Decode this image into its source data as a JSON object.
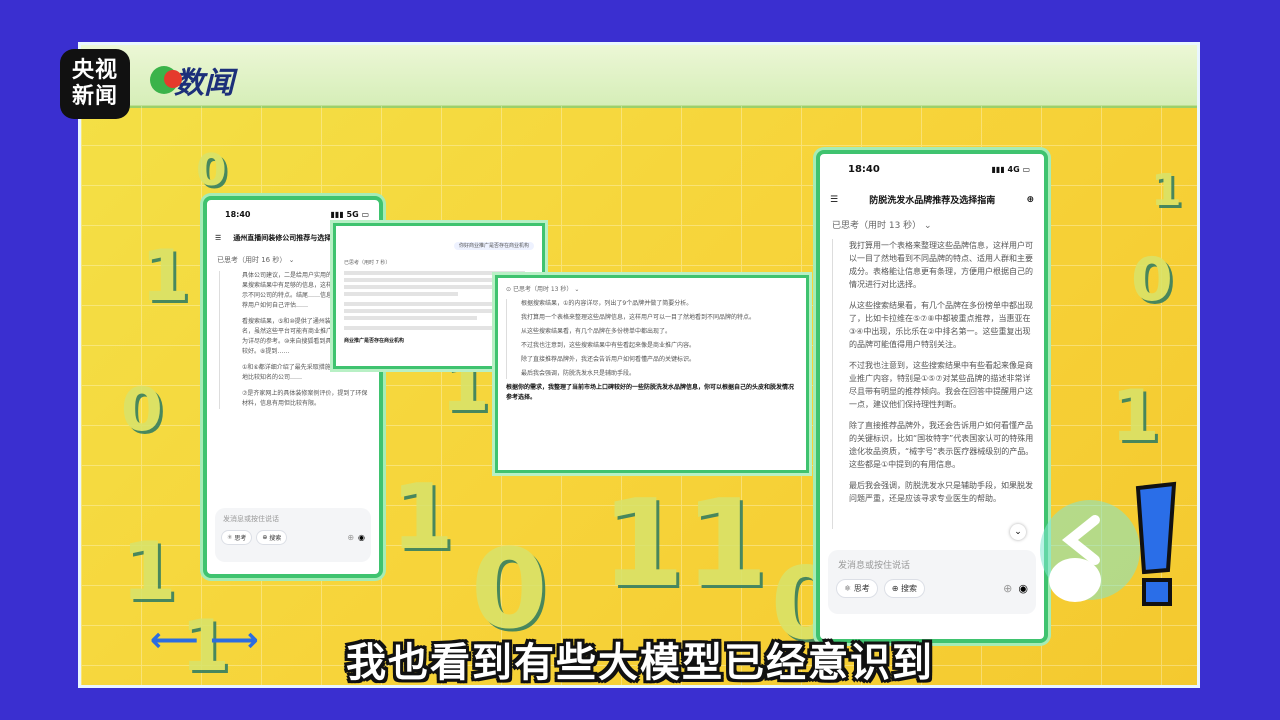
{
  "broadcaster": {
    "logo_line1": "央视",
    "logo_line2": "新闻",
    "brand_name": "数闻"
  },
  "subtitle": "我也看到有些大模型已经意识到",
  "phone_left": {
    "time": "18:40",
    "signal": "5G",
    "title": "通州直播间装修公司推荐与选择",
    "thinking": "已思考（用时 16 秒）",
    "paragraphs": [
      "具体公司建议，二是给用户实用的选择建议。如果搜索结果中有足够的信息，这样比较的方式展示不同公司的特点。结尾……信息，我会重点推荐用户如何自己评估……",
      "看搜索结果，⑤和⑩提供了通州装修公司综合排名，虽然这些平台可能有商业推广，但提供了较为详尽的参考。⑩来自搜狐看到具体信息，信誉较好。⑧提到……",
      "①和⑥都详细介绍了最先采取措施，这是通州本地比较知名的公司……",
      "⑦是齐家网上的具体装修案例评价，提到了环保材料，信息有用但比较有限。"
    ],
    "input_placeholder": "发消息或按住说话",
    "btn_think": "思考",
    "btn_search": "搜索"
  },
  "card_small": {
    "chip": "你好商业推广是否存在商业机构",
    "thinking": "已思考（用时 7 秒）",
    "footer": "商业推广是否存在商业机构"
  },
  "card_middle": {
    "thinking": "已思考（用时 13 秒）",
    "paragraphs": [
      "根据搜索结果，①的内容详尽，列出了9个品牌并做了简要分析。",
      "我打算用一个表格来整理这些品牌信息，这样用户可以一目了然地看到不同品牌的特点。",
      "从这些搜索结果看，有几个品牌在多份榜单中都出现了。",
      "不过我也注意到，这些搜索结果中有些看起来像是商业推广内容。",
      "除了直接推荐品牌外，我还会告诉用户如何看懂产品的关键标识。",
      "最后我会强调，防脱洗发水只是辅助手段。"
    ],
    "answer": "根据你的需求，我整理了当前市场上口碑较好的一些防脱洗发水品牌信息，你可以根据自己的头皮和脱发情况参考选择。"
  },
  "phone_right": {
    "time": "18:40",
    "signal": "4G",
    "title": "防脱洗发水品牌推荐及选择指南",
    "thinking": "已思考（用时 13 秒）",
    "paragraphs": [
      "我打算用一个表格来整理这些品牌信息，这样用户可以一目了然地看到不同品牌的特点、适用人群和主要成分。表格能让信息更有条理，方便用户根据自己的情况进行对比选择。",
      "从这些搜索结果看，有几个品牌在多份榜单中都出现了，比如卡拉维在⑤⑦⑧中都被重点推荐，当惠亚在③④中出现，乐比乐在②中排名第一。这些重复出现的品牌可能值得用户特别关注。",
      "不过我也注意到，这些搜索结果中有些看起来像是商业推广内容，特别是①⑤⑦对某些品牌的描述非常详尽且带有明显的推荐倾向。我会在回答中提醒用户这一点，建议他们保持理性判断。",
      "除了直接推荐品牌外，我还会告诉用户如何看懂产品的关键标识，比如“国妆特字”代表国家认可的特殊用途化妆品资质，“械字号”表示医疗器械级别的产品。这些都是①中提到的有用信息。",
      "最后我会强调，防脱洗发水只是辅助手段，如果脱发问题严重，还是应该寻求专业医生的帮助。"
    ],
    "input_placeholder": "发消息或按住说话",
    "btn_think": "思考",
    "btn_search": "搜索"
  },
  "colors": {
    "background": "#3a2fd0",
    "frame_yellow": "#f4d53a",
    "phone_border": "#3fc36f",
    "subtitle_text": "#ffffff"
  }
}
